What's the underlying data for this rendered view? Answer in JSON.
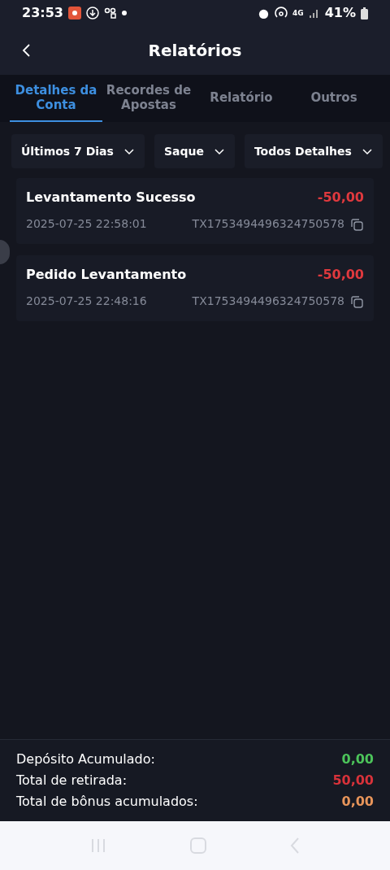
{
  "status_bar": {
    "time": "23:53",
    "battery": "41%",
    "network": "4G"
  },
  "header": {
    "title": "Relatórios"
  },
  "tabs": [
    {
      "label": "Detalhes da Conta",
      "selected": true
    },
    {
      "label": "Recordes de Apostas",
      "selected": false
    },
    {
      "label": "Relatório",
      "selected": false
    },
    {
      "label": "Outros",
      "selected": false
    }
  ],
  "filters": [
    {
      "label": "Últimos 7 Dias"
    },
    {
      "label": "Saque"
    },
    {
      "label": "Todos Detalhes"
    }
  ],
  "transactions": [
    {
      "title": "Levantamento Sucesso",
      "amount": "-50,00",
      "datetime": "2025-07-25 22:58:01",
      "id": "TX1753494496324750578"
    },
    {
      "title": "Pedido Levantamento",
      "amount": "-50,00",
      "datetime": "2025-07-25 22:48:16",
      "id": "TX1753494496324750578"
    }
  ],
  "summary": [
    {
      "label": "Depósito Acumulado:",
      "value": "0,00",
      "color": "#4cc45a"
    },
    {
      "label": "Total de retirada:",
      "value": "50,00",
      "color": "#d8323a"
    },
    {
      "label": "Total de bônus acumulados:",
      "value": "0,00",
      "color": "#e8955a"
    }
  ]
}
